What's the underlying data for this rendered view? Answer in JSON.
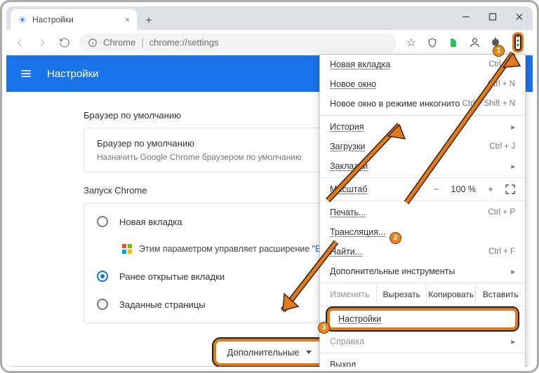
{
  "tab": {
    "title": "Настройки"
  },
  "url": {
    "scheme": "Chrome",
    "path": "chrome://settings"
  },
  "settings": {
    "header": "Настройки",
    "section_default_browser": "Браузер по умолчанию",
    "default_card_title": "Браузер по умолчанию",
    "default_card_sub": "Назначить Google Chrome браузером по умолчанию",
    "section_startup": "Запуск Chrome",
    "radio_new_tab": "Новая вкладка",
    "radio_continue": "Ранее открытые вкладки",
    "radio_specific": "Заданные страницы",
    "ext_prefix": "Этим параметром управляет расширение \"",
    "ext_link": "Визуаль",
    "additional": "Дополнительные"
  },
  "menu": {
    "new_tab": "Новая вкладка",
    "new_tab_sc": "Ctrl + T",
    "new_window": "Новое окно",
    "new_window_sc": "Ctrl + N",
    "incognito": "Новое окно в режиме инкогнито",
    "incognito_sc": "Ctrl + Shift + N",
    "history": "История",
    "downloads": "Загрузки",
    "downloads_sc": "Ctrl + J",
    "bookmarks": "Закладки",
    "zoom_label": "Масштаб",
    "zoom_value": "100 %",
    "print": "Печать...",
    "print_sc": "Ctrl + P",
    "cast": "Трансляция...",
    "find": "Найти...",
    "find_sc": "Ctrl + F",
    "more_tools": "Дополнительные инструменты",
    "edit_label": "Изменить",
    "cut": "Вырезать",
    "copy": "Копировать",
    "paste": "Вставить",
    "settings": "Настройки",
    "help": "Справка",
    "exit": "Выход"
  },
  "badges": {
    "b1": "1",
    "b2": "2",
    "b3": "3"
  }
}
